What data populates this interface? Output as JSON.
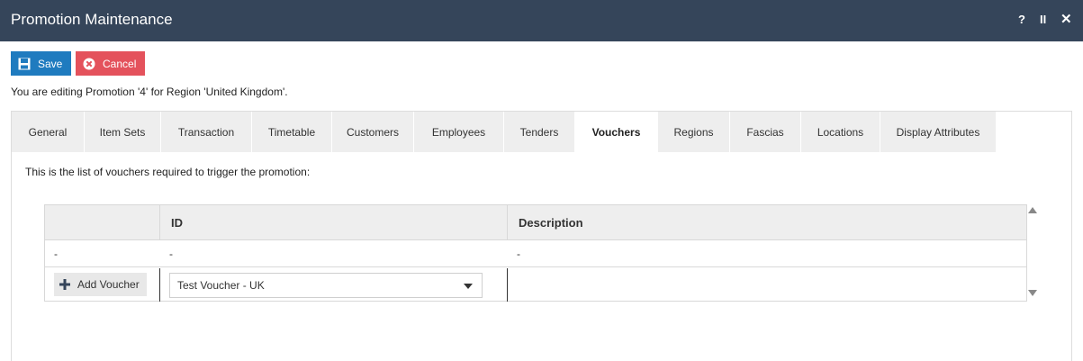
{
  "window": {
    "title": "Promotion Maintenance",
    "help": "?",
    "pause": "II",
    "close": "✕"
  },
  "toolbar": {
    "save_label": "Save",
    "cancel_label": "Cancel"
  },
  "edit_message": "You are editing Promotion '4' for Region 'United Kingdom'.",
  "tabs": [
    {
      "label": "General"
    },
    {
      "label": "Item Sets"
    },
    {
      "label": "Transaction"
    },
    {
      "label": "Timetable"
    },
    {
      "label": "Customers"
    },
    {
      "label": "Employees"
    },
    {
      "label": "Tenders"
    },
    {
      "label": "Vouchers",
      "active": true
    },
    {
      "label": "Regions"
    },
    {
      "label": "Fascias"
    },
    {
      "label": "Locations"
    },
    {
      "label": "Display Attributes"
    }
  ],
  "vouchers": {
    "intro": "This is the list of vouchers required to trigger the promotion:",
    "columns": {
      "action": "",
      "id": "ID",
      "description": "Description"
    },
    "rows": [
      {
        "action": "-",
        "id": "-",
        "description": "-"
      }
    ],
    "add_button_label": "Add Voucher",
    "select_value": "Test Voucher - UK"
  },
  "colors": {
    "titlebar": "#35455a",
    "save": "#1f7bbf",
    "cancel": "#e4525c"
  }
}
